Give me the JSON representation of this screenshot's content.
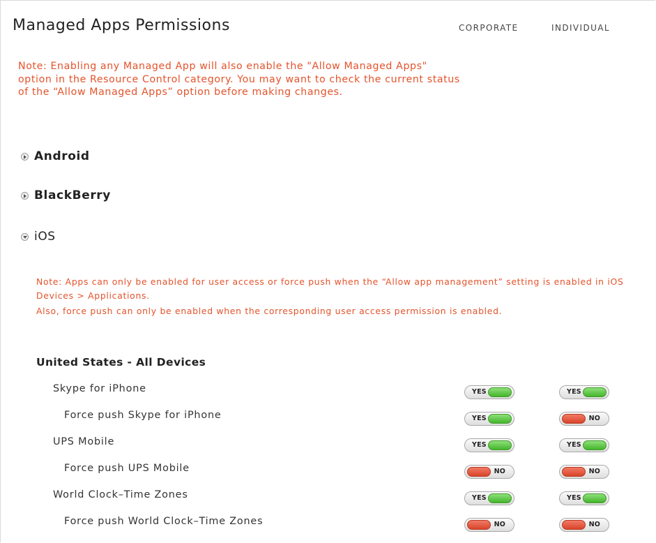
{
  "page": {
    "title": "Managed Apps Permissions",
    "columns": [
      "CORPORATE",
      "INDIVIDUAL"
    ],
    "note": "Note: Enabling any Managed App will also enable the \"Allow Managed Apps\" option in the Resource Control category. You may want to check the current status of the “Allow Managed Apps” option before making changes."
  },
  "sections": [
    {
      "label": "Android",
      "expanded": false
    },
    {
      "label": "BlackBerry",
      "expanded": false
    },
    {
      "label": "iOS",
      "expanded": true
    }
  ],
  "ios": {
    "note_line1": "Note: Apps can only be enabled for user access or force push when the “Allow app management” setting is enabled in iOS Devices > Applications.",
    "note_line2": "Also, force push can only be enabled when the corresponding user access permission is enabled.",
    "group_title": "United States - All Devices",
    "toggle_labels": {
      "yes": "YES",
      "no": "NO"
    },
    "rows": [
      {
        "label": "Skype for iPhone",
        "corporate": "YES",
        "individual": "YES"
      },
      {
        "label": "Force push Skype for iPhone",
        "corporate": "YES",
        "individual": "NO"
      },
      {
        "label": "UPS Mobile",
        "corporate": "YES",
        "individual": "YES"
      },
      {
        "label": "Force push UPS Mobile",
        "corporate": "NO",
        "individual": "NO"
      },
      {
        "label": "World Clock–Time Zones",
        "corporate": "YES",
        "individual": "YES"
      },
      {
        "label": "Force push World Clock–Time Zones",
        "corporate": "NO",
        "individual": "NO"
      }
    ]
  },
  "colors": {
    "note": "#e4532b",
    "yes": "#45b52c",
    "no": "#d9452b"
  }
}
